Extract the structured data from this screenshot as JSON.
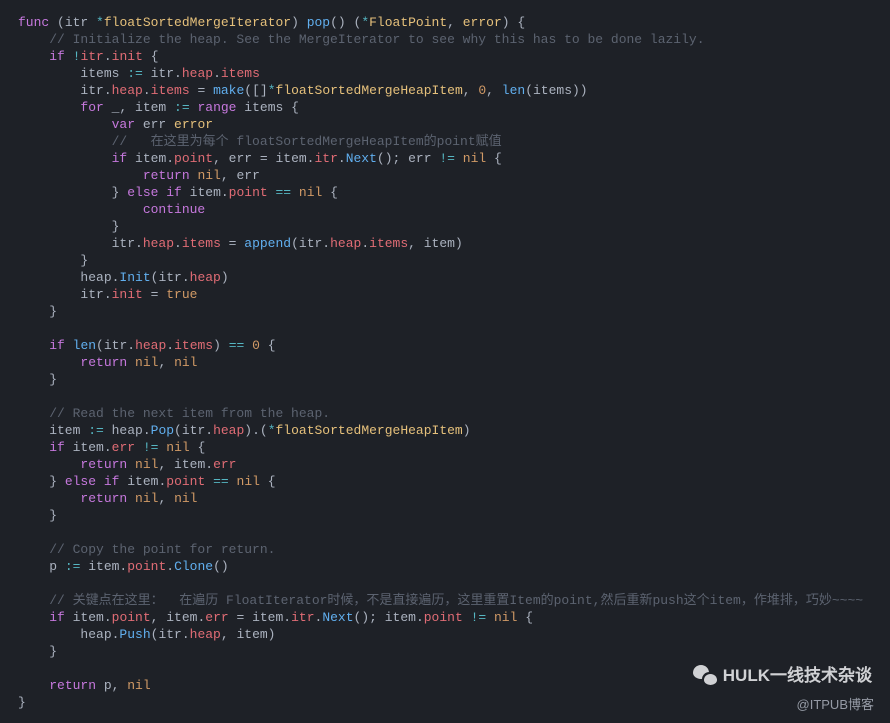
{
  "code": {
    "line01_a": "func",
    "line01_b": " (itr ",
    "line01_c": "*",
    "line01_d": "floatSortedMergeIterator",
    "line01_e": ") ",
    "line01_f": "pop",
    "line01_g": "() (",
    "line01_h": "*",
    "line01_i": "FloatPoint",
    "line01_j": ", ",
    "line01_k": "error",
    "line01_l": ") {",
    "line02": "    // Initialize the heap. See the MergeIterator to see why this has to be done lazily.",
    "line03_a": "    ",
    "line03_b": "if",
    "line03_c": " ",
    "line03_d": "!",
    "line03_e": "itr",
    "line03_f": ".",
    "line03_g": "init",
    "line03_h": " {",
    "line04_a": "        items ",
    "line04_b": ":=",
    "line04_c": " itr.",
    "line04_d": "heap",
    "line04_e": ".",
    "line04_f": "items",
    "line05_a": "        itr.",
    "line05_b": "heap",
    "line05_c": ".",
    "line05_d": "items",
    "line05_e": " = ",
    "line05_f": "make",
    "line05_g": "([]",
    "line05_h": "*",
    "line05_i": "floatSortedMergeHeapItem",
    "line05_j": ", ",
    "line05_k": "0",
    "line05_l": ", ",
    "line05_m": "len",
    "line05_n": "(items))",
    "line06_a": "        ",
    "line06_b": "for",
    "line06_c": " _, item ",
    "line06_d": ":=",
    "line06_e": " ",
    "line06_f": "range",
    "line06_g": " items {",
    "line07_a": "            ",
    "line07_b": "var",
    "line07_c": " err ",
    "line07_d": "error",
    "line08": "            //   在这里为每个 floatSortedMergeHeapItem的point赋值",
    "line09_a": "            ",
    "line09_b": "if",
    "line09_c": " item.",
    "line09_d": "point",
    "line09_e": ", err = item.",
    "line09_f": "itr",
    "line09_g": ".",
    "line09_h": "Next",
    "line09_i": "(); err ",
    "line09_j": "!=",
    "line09_k": " ",
    "line09_l": "nil",
    "line09_m": " {",
    "line10_a": "                ",
    "line10_b": "return",
    "line10_c": " ",
    "line10_d": "nil",
    "line10_e": ", err",
    "line11_a": "            } ",
    "line11_b": "else",
    "line11_c": " ",
    "line11_d": "if",
    "line11_e": " item.",
    "line11_f": "point",
    "line11_g": " ",
    "line11_h": "==",
    "line11_i": " ",
    "line11_j": "nil",
    "line11_k": " {",
    "line12_a": "                ",
    "line12_b": "continue",
    "line13": "            }",
    "line14_a": "            itr.",
    "line14_b": "heap",
    "line14_c": ".",
    "line14_d": "items",
    "line14_e": " = ",
    "line14_f": "append",
    "line14_g": "(itr.",
    "line14_h": "heap",
    "line14_i": ".",
    "line14_j": "items",
    "line14_k": ", item)",
    "line15": "        }",
    "line16_a": "        heap.",
    "line16_b": "Init",
    "line16_c": "(itr.",
    "line16_d": "heap",
    "line16_e": ")",
    "line17_a": "        itr.",
    "line17_b": "init",
    "line17_c": " = ",
    "line17_d": "true",
    "line18": "    }",
    "line19": "",
    "line20_a": "    ",
    "line20_b": "if",
    "line20_c": " ",
    "line20_d": "len",
    "line20_e": "(itr.",
    "line20_f": "heap",
    "line20_g": ".",
    "line20_h": "items",
    "line20_i": ") ",
    "line20_j": "==",
    "line20_k": " ",
    "line20_l": "0",
    "line20_m": " {",
    "line21_a": "        ",
    "line21_b": "return",
    "line21_c": " ",
    "line21_d": "nil",
    "line21_e": ", ",
    "line21_f": "nil",
    "line22": "    }",
    "line23": "",
    "line24": "    // Read the next item from the heap.",
    "line25_a": "    item ",
    "line25_b": ":=",
    "line25_c": " heap.",
    "line25_d": "Pop",
    "line25_e": "(itr.",
    "line25_f": "heap",
    "line25_g": ").(",
    "line25_h": "*",
    "line25_i": "floatSortedMergeHeapItem",
    "line25_j": ")",
    "line26_a": "    ",
    "line26_b": "if",
    "line26_c": " item.",
    "line26_d": "err",
    "line26_e": " ",
    "line26_f": "!=",
    "line26_g": " ",
    "line26_h": "nil",
    "line26_i": " {",
    "line27_a": "        ",
    "line27_b": "return",
    "line27_c": " ",
    "line27_d": "nil",
    "line27_e": ", item.",
    "line27_f": "err",
    "line28_a": "    } ",
    "line28_b": "else",
    "line28_c": " ",
    "line28_d": "if",
    "line28_e": " item.",
    "line28_f": "point",
    "line28_g": " ",
    "line28_h": "==",
    "line28_i": " ",
    "line28_j": "nil",
    "line28_k": " {",
    "line29_a": "        ",
    "line29_b": "return",
    "line29_c": " ",
    "line29_d": "nil",
    "line29_e": ", ",
    "line29_f": "nil",
    "line30": "    }",
    "line31": "",
    "line32": "    // Copy the point for return.",
    "line33_a": "    p ",
    "line33_b": ":=",
    "line33_c": " item.",
    "line33_d": "point",
    "line33_e": ".",
    "line33_f": "Clone",
    "line33_g": "()",
    "line34": "",
    "line35": "    // 关键点在这里：  在遍历 FloatIterator时候，不是直接遍历，这里重置Item的point,然后重新push这个item，作堆排，巧妙~~~~",
    "line36_a": "    ",
    "line36_b": "if",
    "line36_c": " item.",
    "line36_d": "point",
    "line36_e": ", item.",
    "line36_f": "err",
    "line36_g": " = item.",
    "line36_h": "itr",
    "line36_i": ".",
    "line36_j": "Next",
    "line36_k": "(); item.",
    "line36_l": "point",
    "line36_m": " ",
    "line36_n": "!=",
    "line36_o": " ",
    "line36_p": "nil",
    "line36_q": " {",
    "line37_a": "        heap.",
    "line37_b": "Push",
    "line37_c": "(itr.",
    "line37_d": "heap",
    "line37_e": ", item)",
    "line38": "    }",
    "line39": "",
    "line40_a": "    ",
    "line40_b": "return",
    "line40_c": " p, ",
    "line40_d": "nil",
    "line41": "}"
  },
  "watermark_hulk": "HULK一线技术杂谈",
  "watermark_itpub": "@ITPUB博客"
}
